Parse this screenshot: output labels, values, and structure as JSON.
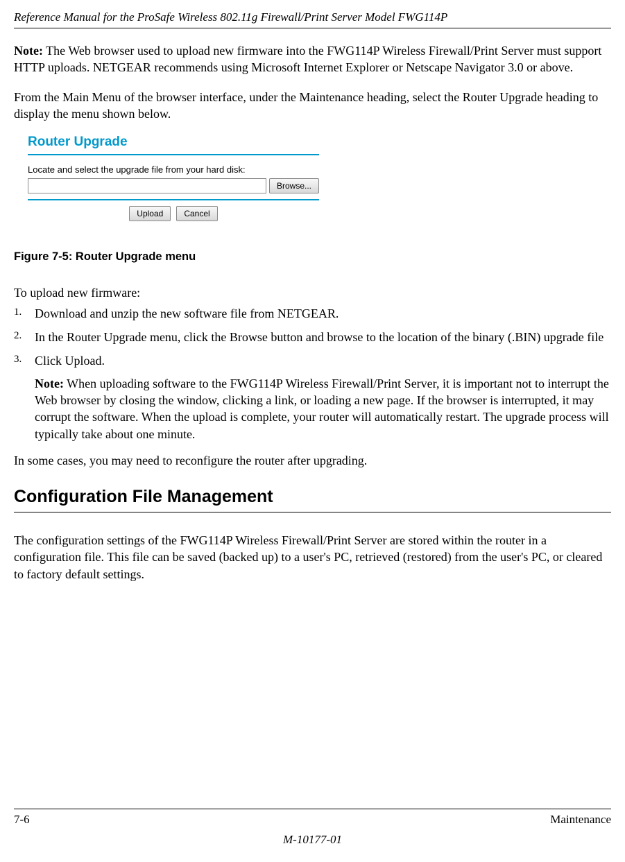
{
  "header": {
    "title": "Reference Manual for the ProSafe Wireless 802.11g  Firewall/Print Server Model FWG114P"
  },
  "note1": {
    "label": "Note:",
    "text": " The Web browser used to upload new firmware into the FWG114P Wireless Firewall/Print Server must support HTTP uploads. NETGEAR recommends using Microsoft Internet Explorer or Netscape Navigator 3.0 or above."
  },
  "para1": "From the Main Menu of the browser interface, under the Maintenance heading, select the Router Upgrade heading to display the menu shown below.",
  "router_upgrade": {
    "title": "Router Upgrade",
    "label": "Locate and select the upgrade file from your hard disk:",
    "browse_btn": "Browse...",
    "upload_btn": "Upload",
    "cancel_btn": "Cancel",
    "file_value": ""
  },
  "figure_caption": "Figure 7-5:  Router Upgrade menu",
  "list_intro": "To upload new firmware:",
  "steps": {
    "n1": "1.",
    "t1": "Download and unzip the new software file from NETGEAR.",
    "n2": "2.",
    "t2": "In the Router Upgrade menu, click the Browse button and browse to the location of the binary (.BIN) upgrade file",
    "n3": "3.",
    "t3": "Click Upload.",
    "note_label": "Note:",
    "note_text": " When uploading software to the FWG114P Wireless Firewall/Print Server, it is important not to interrupt the Web browser by closing the window, clicking a link, or loading a new page. If the browser is interrupted, it may corrupt the software. When the upload is complete, your router will automatically restart. The upgrade process will typically take about one minute."
  },
  "para2": "In some cases, you may need to reconfigure the router after upgrading.",
  "section_heading": "Configuration File Management",
  "para3": "The configuration settings of the FWG114P Wireless Firewall/Print Server are stored within the router in a configuration file. This file can be saved (backed up) to a user's PC, retrieved (restored) from the user's PC, or cleared to factory default settings.",
  "footer": {
    "page": "7-6",
    "section": "Maintenance",
    "docnum": "M-10177-01"
  }
}
